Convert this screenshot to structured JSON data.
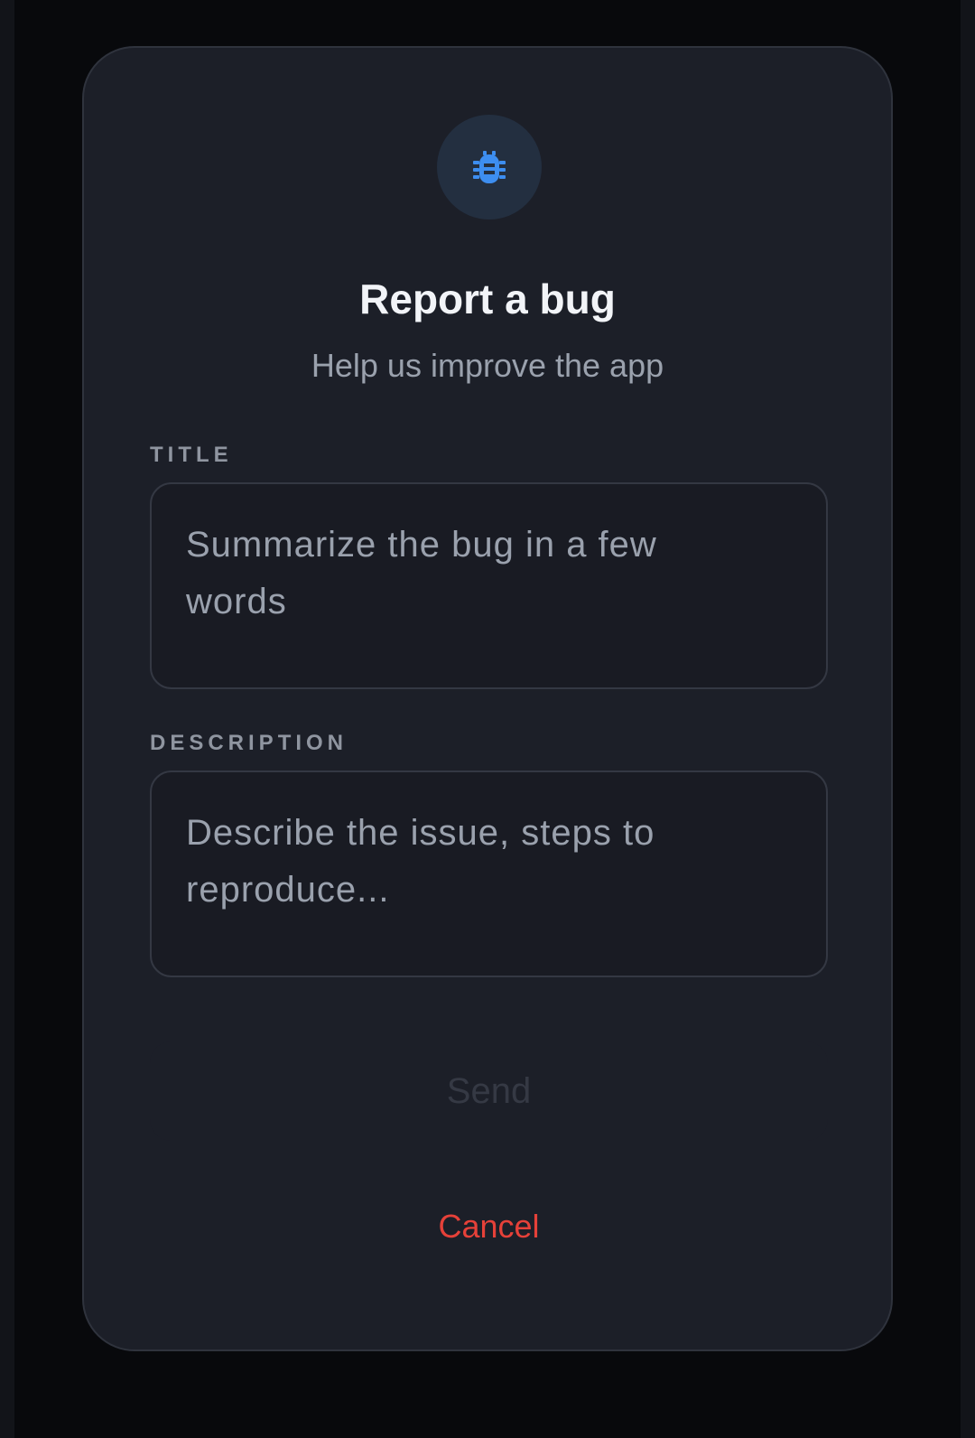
{
  "dialog": {
    "title": "Report a bug",
    "subtitle": "Help us improve the app",
    "icon": "bug-icon"
  },
  "form": {
    "title_label": "TITLE",
    "title_placeholder": "Summarize the bug in a few words",
    "title_value": "",
    "description_label": "DESCRIPTION",
    "description_placeholder": "Describe the issue, steps to reproduce...",
    "description_value": ""
  },
  "actions": {
    "send_label": "Send",
    "send_enabled": false,
    "cancel_label": "Cancel"
  },
  "colors": {
    "accent": "#3d8ef0",
    "danger": "#e64139",
    "surface": "#1c1f28",
    "background": "#08090c"
  }
}
